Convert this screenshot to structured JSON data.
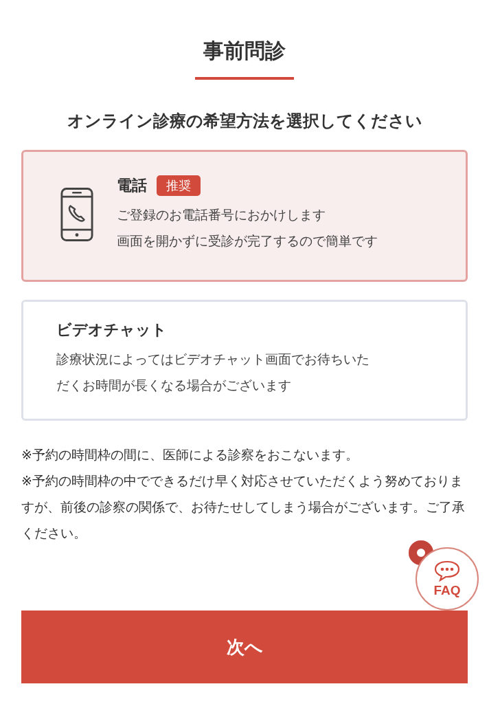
{
  "page_title": "事前問診",
  "question": "オンライン診療の希望方法を選択してください",
  "options": [
    {
      "kind": "phone",
      "title": "電話",
      "badge": "推奨",
      "selected": true,
      "lines": [
        "ご登録のお電話番号におかけします",
        "画面を開かずに受診が完了するので簡単です"
      ]
    },
    {
      "kind": "video",
      "title": "ビデオチャット",
      "selected": false,
      "lines": [
        "診療状況によってはビデオチャット画面でお待ちいた",
        "だくお時間が長くなる場合がございます"
      ]
    }
  ],
  "notes": [
    "※予約の時間枠の間に、医師による診察をおこないます。",
    "※予約の時間枠の中でできるだけ早く対応させていただくよう努めておりますが、前後の診察の関係で、お待たせしてしまう場合がございます。ご了承ください。"
  ],
  "faq": {
    "label": "FAQ"
  },
  "next_button": "次へ"
}
